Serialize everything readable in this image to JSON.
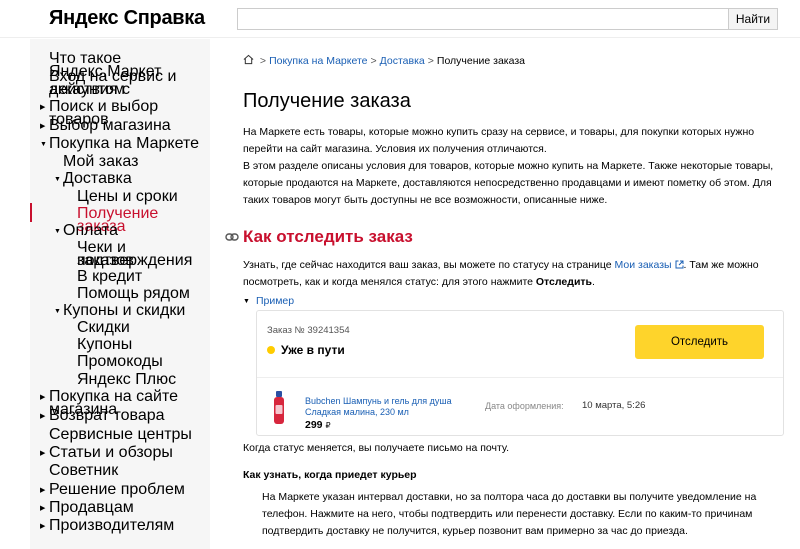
{
  "header": {
    "logo": "Яндекс Справка",
    "search_placeholder": "",
    "search_button": "Найти"
  },
  "sidebar": {
    "items": [
      {
        "label": "Что такое Яндекс.Маркет",
        "arrow": ""
      },
      {
        "label": "Вход на сервис и действия с",
        "arrow": ""
      },
      {
        "label": "аккаунтом",
        "arrow": ""
      },
      {
        "label": "Поиск и выбор товаров",
        "arrow": "▶"
      },
      {
        "label": "Выбор магазина",
        "arrow": "▶"
      },
      {
        "label": "Покупка на Маркете",
        "arrow": "▼"
      },
      {
        "label": "Мой заказ",
        "arrow": ""
      },
      {
        "label": "Доставка",
        "arrow": "▼"
      },
      {
        "label": "Цены и сроки",
        "arrow": ""
      },
      {
        "label": "Получение заказа",
        "arrow": ""
      },
      {
        "label": "Оплата",
        "arrow": "▼"
      },
      {
        "label": "Чеки и подтверждения",
        "arrow": ""
      },
      {
        "label": "заказов",
        "arrow": ""
      },
      {
        "label": "В кредит",
        "arrow": ""
      },
      {
        "label": "Помощь рядом",
        "arrow": ""
      },
      {
        "label": "Купоны и скидки",
        "arrow": "▼"
      },
      {
        "label": "Скидки",
        "arrow": ""
      },
      {
        "label": "Купоны",
        "arrow": ""
      },
      {
        "label": "Промокоды",
        "arrow": ""
      },
      {
        "label": "Яндекс Плюс",
        "arrow": ""
      },
      {
        "label": "Покупка на сайте магазина",
        "arrow": "▶"
      },
      {
        "label": "Возврат товара",
        "arrow": "▶"
      },
      {
        "label": "Сервисные центры",
        "arrow": ""
      },
      {
        "label": "Статьи и обзоры",
        "arrow": "▶"
      },
      {
        "label": "Советник",
        "arrow": ""
      },
      {
        "label": "Решение проблем",
        "arrow": "▶"
      },
      {
        "label": "Продавцам",
        "arrow": "▶"
      },
      {
        "label": "Производителям",
        "arrow": "▶"
      }
    ]
  },
  "breadcrumb": {
    "items": [
      "Покупка на Маркете",
      "Доставка"
    ],
    "current": "Получение заказа",
    "separator": ">"
  },
  "page": {
    "title": "Получение заказа",
    "intro_1": "На Маркете есть товары, которые можно купить сразу на сервисе, и товары, для покупки которых нужно перейти на сайт магазина. Условия их получения отличаются.",
    "intro_2": "В этом разделе описаны условия для товаров, которые можно купить на Маркете. Также некоторые товары, которые продаются на Маркете, доставляются непосредственно продавцами и имеют пометку об этом. Для таких товаров могут быть доступны не все возможности, описанные ниже.",
    "section_title": "Как отследить заказ",
    "track_text_1": "Узнать, где сейчас находится ваш заказ, вы можете по статусу на странице ",
    "track_link": "Мои заказы",
    "track_text_2": ". Там же можно посмотреть, как и когда менялся статус: для этого нажмите ",
    "track_bold": "Отследить",
    "track_text_3": ".",
    "example_label": "Пример",
    "status_change_text": "Когда статус меняется, вы получаете письмо на почту.",
    "courier_heading": "Как узнать, когда приедет курьер",
    "courier_text": "На Маркете указан интервал доставки, но за полтора часа до доставки вы получите уведомление на телефон. Нажмите на него, чтобы подтвердить или перенести доставку. Если по каким-то причинам подтвердить доставку не получится, курьер позвонит вам примерно за час до приезда."
  },
  "example_card": {
    "order_number": "Заказ № 39241354",
    "status": "Уже в пути",
    "track_button": "Отследить",
    "product_name": "Bubchen Шампунь и гель для душа Сладкая малина, 230 мл",
    "price": "299",
    "currency": "₽",
    "date_label": "Дата оформления:",
    "date_value": "10 марта, 5:26"
  },
  "colors": {
    "accent_red": "#c8102e",
    "link_blue": "#1a5fb4",
    "button_yellow": "#fed42b",
    "status_dot": "#ffcc00"
  }
}
